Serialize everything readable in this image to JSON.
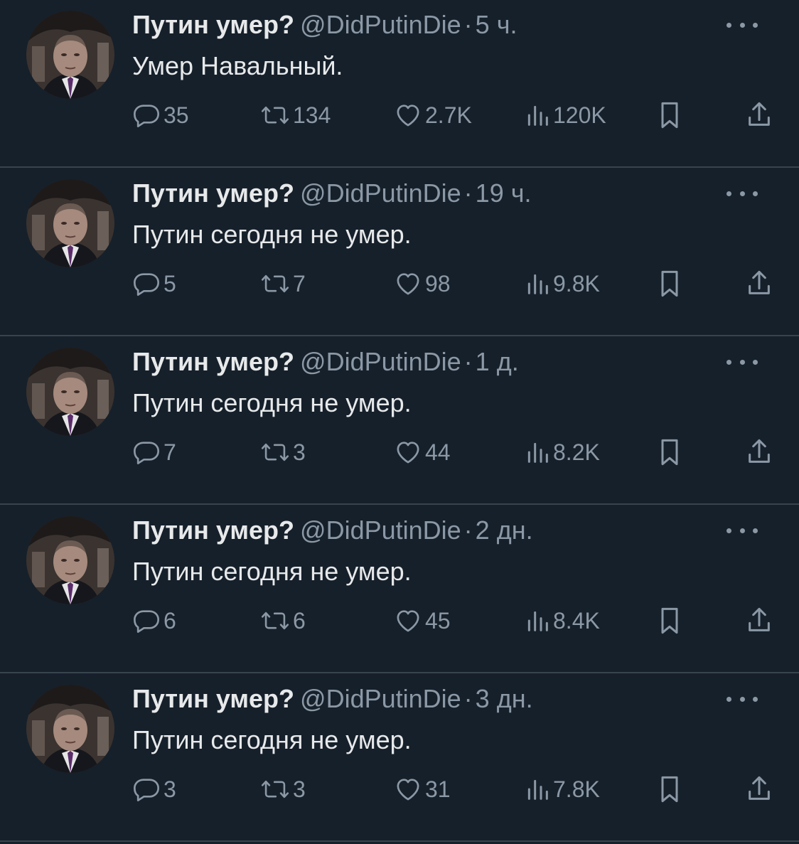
{
  "colors": {
    "background": "#16202b",
    "primary_text": "#e7e9ea",
    "secondary_text": "#8b98a5",
    "divider": "#38444d"
  },
  "tweets": [
    {
      "display_name": "Путин умер?",
      "handle": "@DidPutinDie",
      "separator": "·",
      "time": "5 ч.",
      "text": "Умер Навальный.",
      "replies": "35",
      "retweets": "134",
      "likes": "2.7K",
      "views": "120K"
    },
    {
      "display_name": "Путин умер?",
      "handle": "@DidPutinDie",
      "separator": "·",
      "time": "19 ч.",
      "text": "Путин сегодня не умер.",
      "replies": "5",
      "retweets": "7",
      "likes": "98",
      "views": "9.8K"
    },
    {
      "display_name": "Путин умер?",
      "handle": "@DidPutinDie",
      "separator": "·",
      "time": "1 д.",
      "text": "Путин сегодня не умер.",
      "replies": "7",
      "retweets": "3",
      "likes": "44",
      "views": "8.2K"
    },
    {
      "display_name": "Путин умер?",
      "handle": "@DidPutinDie",
      "separator": "·",
      "time": "2 дн.",
      "text": "Путин сегодня не умер.",
      "replies": "6",
      "retweets": "6",
      "likes": "45",
      "views": "8.4K"
    },
    {
      "display_name": "Путин умер?",
      "handle": "@DidPutinDie",
      "separator": "·",
      "time": "3 дн.",
      "text": "Путин сегодня не умер.",
      "replies": "3",
      "retweets": "3",
      "likes": "31",
      "views": "7.8K"
    }
  ],
  "icons": {
    "avatar": "avatar",
    "more": "more-icon",
    "reply": "reply-icon",
    "retweet": "retweet-icon",
    "like": "like-icon",
    "views": "views-icon",
    "bookmark": "bookmark-icon",
    "share": "share-icon"
  }
}
